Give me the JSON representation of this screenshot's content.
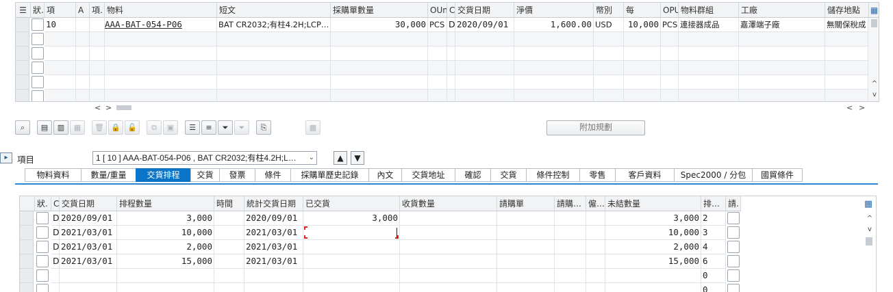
{
  "top_table": {
    "headers": [
      "狀.",
      "項",
      "A",
      "項.",
      "物料",
      "短文",
      "採購單數量",
      "OUn",
      "C",
      "交貨日期",
      "淨價",
      "幣別",
      "每",
      "OPU",
      "物料群組",
      "工廠",
      "儲存地點"
    ],
    "row": {
      "item": "10",
      "material": "AAA-BAT-054-P06",
      "short_text": "BAT CR2032;有柱4.2H;LCP…",
      "po_qty": "30,000",
      "oun": "PCS",
      "c": "D",
      "delivery_date": "2020/09/01",
      "net_price": "1,600.00",
      "currency": "USD",
      "per": "10,000",
      "opu": "PCS",
      "material_group": "連接器成品",
      "plant": "嘉澤端子廠",
      "storage": "無關保稅成"
    }
  },
  "toolbar": {
    "additional_planning": "附加規劃"
  },
  "item_bar": {
    "label": "項目",
    "selected": "1 [ 10 ] AAA-BAT-054-P06 , BAT CR2032;有柱4.2H;L…"
  },
  "tabs": [
    "物料資料",
    "數量/重量",
    "交貨排程",
    "交貨",
    "發票",
    "條件",
    "採購單歷史記錄",
    "內文",
    "交貨地址",
    "確認",
    "交貨",
    "條件控制",
    "零售",
    "客戶資料",
    "Spec2000 / 分包",
    "國貿條件"
  ],
  "active_tab": "交貨排程",
  "schedule_table": {
    "headers": [
      "狀.",
      "C",
      "交貨日期",
      "排程數量",
      "時間",
      "統計交貨日期",
      "已交貨",
      "收貨數量",
      "請購單",
      "請購…",
      "僱…",
      "未結數量",
      "排…",
      "請."
    ],
    "rows": [
      {
        "c": "D",
        "date": "2020/09/01",
        "qty": "3,000",
        "stat_date": "2020/09/01",
        "delivered": "3,000",
        "open": "3,000",
        "seq": "2"
      },
      {
        "c": "D",
        "date": "2021/03/01",
        "qty": "10,000",
        "stat_date": "2021/03/01",
        "delivered": "",
        "open": "10,000",
        "seq": "3"
      },
      {
        "c": "D",
        "date": "2021/03/01",
        "qty": "2,000",
        "stat_date": "2021/03/01",
        "delivered": "",
        "open": "2,000",
        "seq": "4"
      },
      {
        "c": "D",
        "date": "2021/03/01",
        "qty": "15,000",
        "stat_date": "2021/03/01",
        "delivered": "",
        "open": "15,000",
        "seq": "6"
      },
      {
        "c": "",
        "date": "",
        "qty": "",
        "stat_date": "",
        "delivered": "",
        "open": "",
        "seq": "0"
      },
      {
        "c": "",
        "date": "",
        "qty": "",
        "stat_date": "",
        "delivered": "",
        "open": "",
        "seq": "0"
      }
    ]
  },
  "icons": {
    "scroll_up": "^",
    "scroll_down": "v",
    "left": "<",
    "right": ">"
  },
  "colors": {
    "accent": "#0a74c9"
  }
}
